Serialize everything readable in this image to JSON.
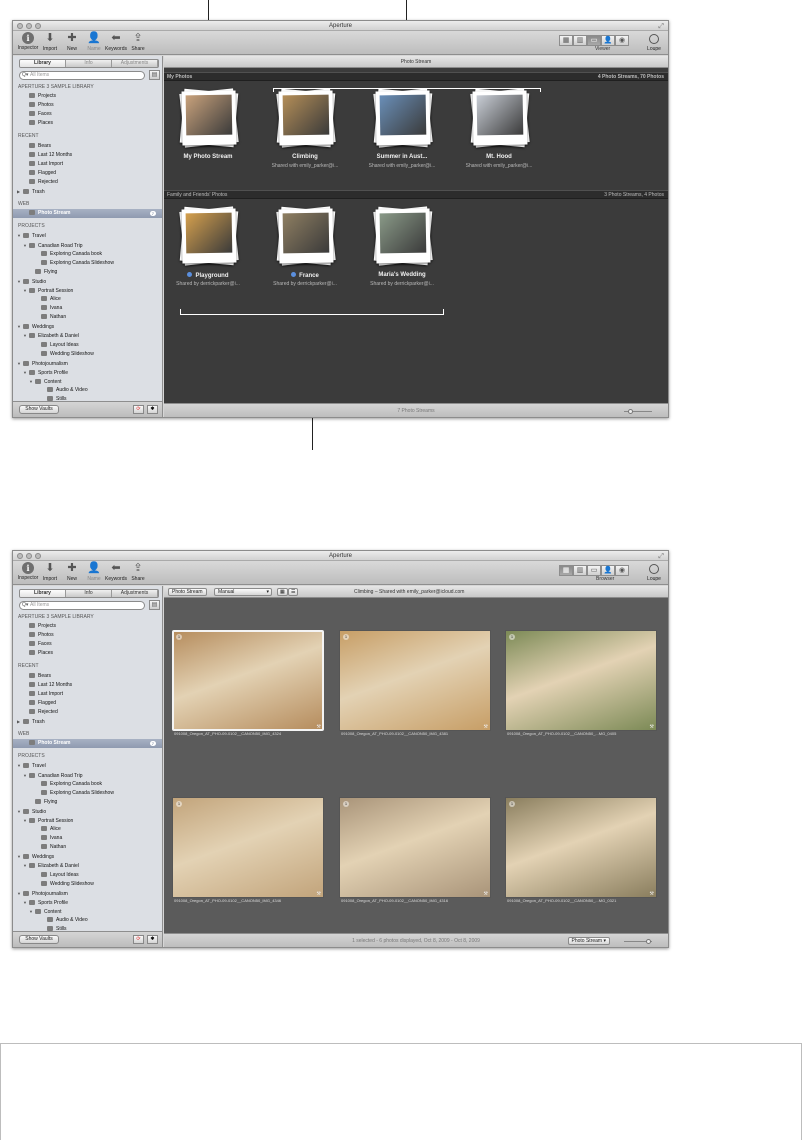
{
  "window1": {
    "title": "Aperture",
    "toolbar": {
      "buttons": [
        {
          "label": "Inspector",
          "icon": "info-icon",
          "glyph": "i"
        },
        {
          "label": "Import",
          "icon": "import-arrow-icon",
          "glyph": "⬇"
        },
        {
          "label": "New",
          "icon": "plus-icon",
          "glyph": "✚"
        },
        {
          "label": "Name",
          "icon": "person-icon",
          "glyph": "👤"
        },
        {
          "label": "Keywords",
          "icon": "tag-icon",
          "glyph": "⬅"
        },
        {
          "label": "Share",
          "icon": "share-icon",
          "glyph": "⇪"
        }
      ],
      "viewer_label": "Viewer",
      "loupe_label": "Loupe"
    },
    "tabs": [
      "Library",
      "Info",
      "Adjustments"
    ],
    "search_placeholder": "All Items",
    "main_header": "Photo Stream",
    "section_my_photos": {
      "title": "My Photos",
      "count": "4 Photo Streams, 70 Photos"
    },
    "section_family": {
      "title": "Family and Friends' Photos",
      "count": "3 Photo Streams, 4 Photos"
    },
    "my_streams": [
      {
        "title": "My Photo Stream",
        "subtitle": "",
        "color": "#c9a27c"
      },
      {
        "title": "Climbing",
        "subtitle": "Shared with emily_parker@i...",
        "color": "#b48e58"
      },
      {
        "title": "Summer in Aust...",
        "subtitle": "Shared with emily_parker@i...",
        "color": "#6a8fb8"
      },
      {
        "title": "Mt. Hood",
        "subtitle": "Shared with emily_parker@i...",
        "color": "#c9ced6"
      }
    ],
    "family_streams": [
      {
        "title": "Playground",
        "subtitle": "Shared by derrickparker@i...",
        "color": "#d5a04e"
      },
      {
        "title": "France",
        "subtitle": "Shared by derrickparker@i...",
        "color": "#8f7f62"
      },
      {
        "title": "Maria's Wedding",
        "subtitle": "Shared by derrickparker@i...",
        "color": "#8a9a88"
      }
    ],
    "footer": "7 Photo Streams"
  },
  "window2": {
    "title": "Aperture",
    "toolbar": {
      "buttons": [
        {
          "label": "Inspector",
          "icon": "info-icon",
          "glyph": "i"
        },
        {
          "label": "Import",
          "icon": "import-arrow-icon",
          "glyph": "⬇"
        },
        {
          "label": "New",
          "icon": "plus-icon",
          "glyph": "✚"
        },
        {
          "label": "Name",
          "icon": "person-icon",
          "glyph": "👤"
        },
        {
          "label": "Keywords",
          "icon": "tag-icon",
          "glyph": "⬅"
        },
        {
          "label": "Share",
          "icon": "share-icon",
          "glyph": "⇪"
        }
      ],
      "browser_label": "Browser",
      "loupe_label": "Loupe"
    },
    "tabs": [
      "Library",
      "Info",
      "Adjustments"
    ],
    "search_placeholder": "All Items",
    "browser_toolbar": {
      "back": "Photo Stream",
      "sort": "Manual",
      "title": "Climbing – Shared with emily_parker@icloud.com"
    },
    "thumbnails": [
      {
        "caption": "091008_Oregon_AT_PHO-09-0102__CANON50_IMG_4324",
        "color": "#b68d5e",
        "selected": true
      },
      {
        "caption": "091008_Oregon_AT_PHO-09-0102__CANON50_IMG_4381",
        "color": "#c79e66",
        "selected": false
      },
      {
        "caption": "091008_Oregon_AT_PHO-09-0102__CANON50_...MG_0405",
        "color": "#7c8a56",
        "selected": false
      },
      {
        "caption": "091008_Oregon_AT_PHO-09-0102__CANON50_IMG_4346",
        "color": "#c2a47b",
        "selected": false
      },
      {
        "caption": "091008_Oregon_AT_PHO-09-0102__CANON50_IMG_4316",
        "color": "#a99479",
        "selected": false
      },
      {
        "caption": "091008_Oregon_AT_PHO-09-0102__CANON50_...MG_0321",
        "color": "#8a7e5e",
        "selected": false
      }
    ],
    "footer": "1 selected - 6 photos displayed, Oct 8, 2009 - Oct 8, 2009",
    "footer_select": "Photo Stream"
  },
  "library": {
    "show_vaults": "Show Vaults",
    "rows": [
      {
        "label": "APERTURE 3 SAMPLE LIBRARY",
        "type": "hdr",
        "indent": 0
      },
      {
        "label": "Projects",
        "indent": 1
      },
      {
        "label": "Photos",
        "indent": 1
      },
      {
        "label": "Faces",
        "indent": 1
      },
      {
        "label": "Places",
        "indent": 1
      },
      {
        "label": "",
        "type": "gap"
      },
      {
        "label": "RECENT",
        "type": "hdr",
        "indent": 0
      },
      {
        "label": "Bears",
        "indent": 1
      },
      {
        "label": "Last 12 Months",
        "indent": 1
      },
      {
        "label": "Last Import",
        "indent": 1
      },
      {
        "label": "Flagged",
        "indent": 1
      },
      {
        "label": "Rejected",
        "indent": 1
      },
      {
        "label": "Trash",
        "indent": 0,
        "tri": "▶"
      },
      {
        "label": "",
        "type": "gap"
      },
      {
        "label": "WEB",
        "type": "hdr",
        "indent": 0
      },
      {
        "label": "Photo Stream",
        "indent": 1,
        "selected": true,
        "badge": "7"
      },
      {
        "label": "",
        "type": "gap"
      },
      {
        "label": "PROJECTS",
        "type": "hdr",
        "indent": 0
      },
      {
        "label": "Travel",
        "indent": 0,
        "tri": "▼"
      },
      {
        "label": "Canadian Road Trip",
        "indent": 1,
        "tri": "▼"
      },
      {
        "label": "Exploring Canada book",
        "indent": 3
      },
      {
        "label": "Exploring Canada Slideshow",
        "indent": 3
      },
      {
        "label": "Flying",
        "indent": 2
      },
      {
        "label": "Studio",
        "indent": 0,
        "tri": "▼"
      },
      {
        "label": "Portrait Session",
        "indent": 1,
        "tri": "▼"
      },
      {
        "label": "Alice",
        "indent": 3
      },
      {
        "label": "Ivana",
        "indent": 3
      },
      {
        "label": "Nathan",
        "indent": 3
      },
      {
        "label": "Weddings",
        "indent": 0,
        "tri": "▼"
      },
      {
        "label": "Elizabeth & Daniel",
        "indent": 1,
        "tri": "▼"
      },
      {
        "label": "Layout Ideas",
        "indent": 3
      },
      {
        "label": "Wedding Slideshow",
        "indent": 3
      },
      {
        "label": "Photojournalism",
        "indent": 0,
        "tri": "▼"
      },
      {
        "label": "Sports Profile",
        "indent": 1,
        "tri": "▼"
      },
      {
        "label": "Content",
        "indent": 2,
        "tri": "▼"
      },
      {
        "label": "Audio & Video",
        "indent": 4
      },
      {
        "label": "Stills",
        "indent": 4
      }
    ]
  }
}
